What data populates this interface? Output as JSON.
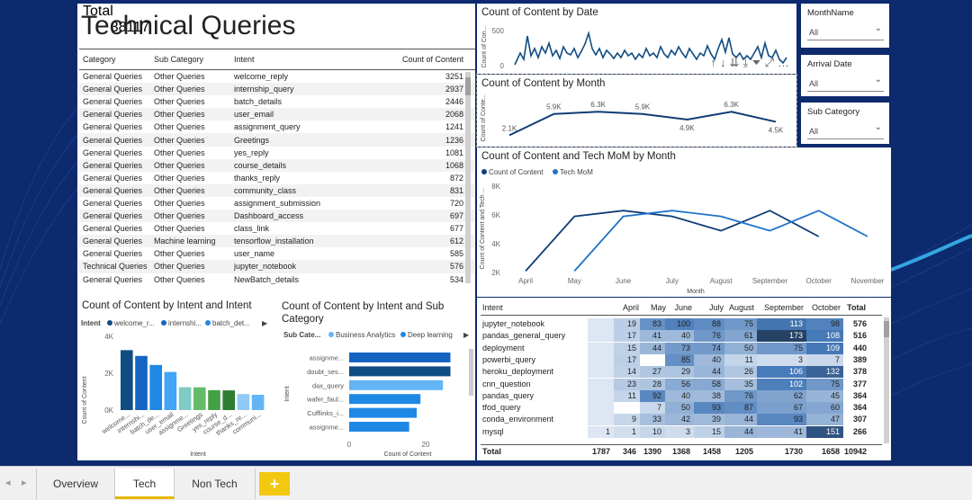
{
  "report": {
    "title": "Technical Queries"
  },
  "table": {
    "headers": [
      "Category",
      "Sub Category",
      "Intent",
      "Count of Content"
    ],
    "rows": [
      [
        "General Queries",
        "Other Queries",
        "welcome_reply",
        "3251"
      ],
      [
        "General Queries",
        "Other Queries",
        "internship_query",
        "2937"
      ],
      [
        "General Queries",
        "Other Queries",
        "batch_details",
        "2446"
      ],
      [
        "General Queries",
        "Other Queries",
        "user_email",
        "2068"
      ],
      [
        "General Queries",
        "Other Queries",
        "assignment_query",
        "1241"
      ],
      [
        "General Queries",
        "Other Queries",
        "Greetings",
        "1236"
      ],
      [
        "General Queries",
        "Other Queries",
        "yes_reply",
        "1081"
      ],
      [
        "General Queries",
        "Other Queries",
        "course_details",
        "1068"
      ],
      [
        "General Queries",
        "Other Queries",
        "thanks_reply",
        "872"
      ],
      [
        "General Queries",
        "Other Queries",
        "community_class",
        "831"
      ],
      [
        "General Queries",
        "Other Queries",
        "assignment_submission",
        "720"
      ],
      [
        "General Queries",
        "Other Queries",
        "Dashboard_access",
        "697"
      ],
      [
        "General Queries",
        "Other Queries",
        "class_link",
        "677"
      ],
      [
        "General Queries",
        "Machine learning",
        "tensorflow_installation",
        "612"
      ],
      [
        "General Queries",
        "Other Queries",
        "user_name",
        "585"
      ],
      [
        "Technical Queries",
        "Other Queries",
        "jupyter_notebook",
        "576"
      ],
      [
        "General Queries",
        "Other Queries",
        "NewBatch_details",
        "534"
      ]
    ],
    "total_label": "Total",
    "total_value": "38117"
  },
  "date_chart": {
    "title": "Count of Content by Date",
    "ylabel": "Count of Con...",
    "yticks": [
      "500",
      "0"
    ]
  },
  "month_chart": {
    "title": "Count of Content by Month",
    "ylabel": "Count of Conte...",
    "chart_data": {
      "type": "line",
      "categories": [
        "April",
        "May",
        "June",
        "July",
        "August",
        "September",
        "October"
      ],
      "values": [
        2100,
        5900,
        6300,
        5900,
        4900,
        6300,
        4500
      ],
      "labels": [
        "2.1K",
        "5.9K",
        "6.3K",
        "5.9K",
        "4.9K",
        "6.3K",
        "4.5K"
      ]
    }
  },
  "mom_chart": {
    "title": "Count of Content and Tech MoM by Month",
    "legend": [
      "Count of Content",
      "Tech MoM"
    ],
    "ylabel": "Count of Content and Tech ...",
    "xlabel": "Month",
    "yticks": [
      "8K",
      "6K",
      "4K",
      "2K"
    ],
    "chart_data": {
      "type": "line",
      "categories": [
        "April",
        "May",
        "June",
        "July",
        "August",
        "September",
        "October",
        "November"
      ],
      "series": [
        {
          "name": "Count of Content",
          "values": [
            2100,
            5900,
            6300,
            5900,
            4900,
            6300,
            4500,
            null
          ]
        },
        {
          "name": "Tech MoM",
          "values": [
            null,
            2100,
            5900,
            6300,
            5900,
            4900,
            6300,
            4500
          ]
        }
      ],
      "ylim": [
        2000,
        8000
      ]
    }
  },
  "intent_chart": {
    "title": "Count of Content by Intent and Intent",
    "legend_title": "Intent",
    "legend": [
      "welcome_r...",
      "internshi...",
      "batch_det..."
    ],
    "ylabel": "Count of Content",
    "xlabel": "Intent",
    "yticks": [
      "4K",
      "2K",
      "0K"
    ],
    "chart_data": {
      "type": "bar",
      "categories": [
        "welcome...",
        "internshi...",
        "batch_de...",
        "user_email",
        "assignme...",
        "Greetings",
        "yes_reply",
        "course_d...",
        "thanks_re...",
        "communi..."
      ],
      "values": [
        3251,
        2937,
        2446,
        2068,
        1241,
        1236,
        1081,
        1068,
        872,
        831
      ],
      "colors": [
        "#0f4c81",
        "#1565c0",
        "#1e88e5",
        "#42a5f5",
        "#80cbc4",
        "#66bb6a",
        "#43a047",
        "#2e7d32",
        "#90caf9",
        "#64b5f6"
      ],
      "ylim": [
        0,
        4000
      ]
    }
  },
  "subcat_chart": {
    "title": "Count of Content by Intent and Sub Category",
    "legend_title": "Sub Cate...",
    "legend": [
      "Business Analytics",
      "Deep learning"
    ],
    "ylabel": "Intent",
    "xlabel": "Count of Content",
    "xticks": [
      "0",
      "20"
    ],
    "chart_data": {
      "type": "bar",
      "categories": [
        "assignme...",
        "doubt_ses...",
        "dax_query",
        "wafer_faul...",
        "Cufflinks_i...",
        "assignme..."
      ],
      "values": [
        27,
        27,
        25,
        19,
        18,
        16
      ],
      "colors": [
        "#1565c0",
        "#0f4c81",
        "#64b5f6",
        "#1e88e5",
        "#1e88e5",
        "#1e88e5"
      ],
      "xlim": [
        0,
        30
      ]
    }
  },
  "matrix": {
    "headers": [
      "Intent",
      "April",
      "May",
      "June",
      "July",
      "August",
      "September",
      "October",
      "Total"
    ],
    "rows": [
      {
        "intent": "jupyter_notebook",
        "vals": [
          "",
          "19",
          "83",
          "100",
          "88",
          "75",
          "113",
          "98"
        ],
        "total": "576"
      },
      {
        "intent": "pandas_general_query",
        "vals": [
          "",
          "17",
          "41",
          "40",
          "76",
          "61",
          "173",
          "108"
        ],
        "total": "516"
      },
      {
        "intent": "deployment",
        "vals": [
          "",
          "15",
          "44",
          "73",
          "74",
          "50",
          "75",
          "109"
        ],
        "total": "440"
      },
      {
        "intent": "powerbi_query",
        "vals": [
          "",
          "17",
          "",
          "85",
          "40",
          "11",
          "3",
          "7"
        ],
        "total": "389"
      },
      {
        "intent": "heroku_deployment",
        "vals": [
          "",
          "14",
          "27",
          "29",
          "44",
          "26",
          "106",
          "132"
        ],
        "total": "378"
      },
      {
        "intent": "cnn_question",
        "vals": [
          "",
          "23",
          "28",
          "56",
          "58",
          "35",
          "102",
          "75"
        ],
        "total": "377"
      },
      {
        "intent": "pandas_query",
        "vals": [
          "",
          "11",
          "92",
          "40",
          "38",
          "76",
          "62",
          "45"
        ],
        "total": "364"
      },
      {
        "intent": "tfod_query",
        "vals": [
          "",
          "",
          "7",
          "50",
          "93",
          "87",
          "67",
          "60"
        ],
        "total": "364"
      },
      {
        "intent": "conda_environment",
        "vals": [
          "",
          "9",
          "33",
          "42",
          "39",
          "44",
          "93",
          "47"
        ],
        "total": "307"
      },
      {
        "intent": "mysql",
        "vals": [
          "1",
          "1",
          "10",
          "3",
          "15",
          "44",
          "41",
          "151"
        ],
        "total": "266"
      }
    ],
    "total_label": "Total",
    "totals": [
      "1787",
      "346",
      "1390",
      "1368",
      "1458",
      "1205",
      "1730",
      "1658"
    ],
    "grand_total": "10942"
  },
  "slicers": [
    {
      "label": "MonthName",
      "value": "All"
    },
    {
      "label": "Arrival Date",
      "value": "All"
    },
    {
      "label": "Sub Category",
      "value": "All"
    }
  ],
  "tabs": [
    {
      "label": "Overview"
    },
    {
      "label": "Tech"
    },
    {
      "label": "Non Tech"
    },
    {
      "label": "+"
    }
  ]
}
